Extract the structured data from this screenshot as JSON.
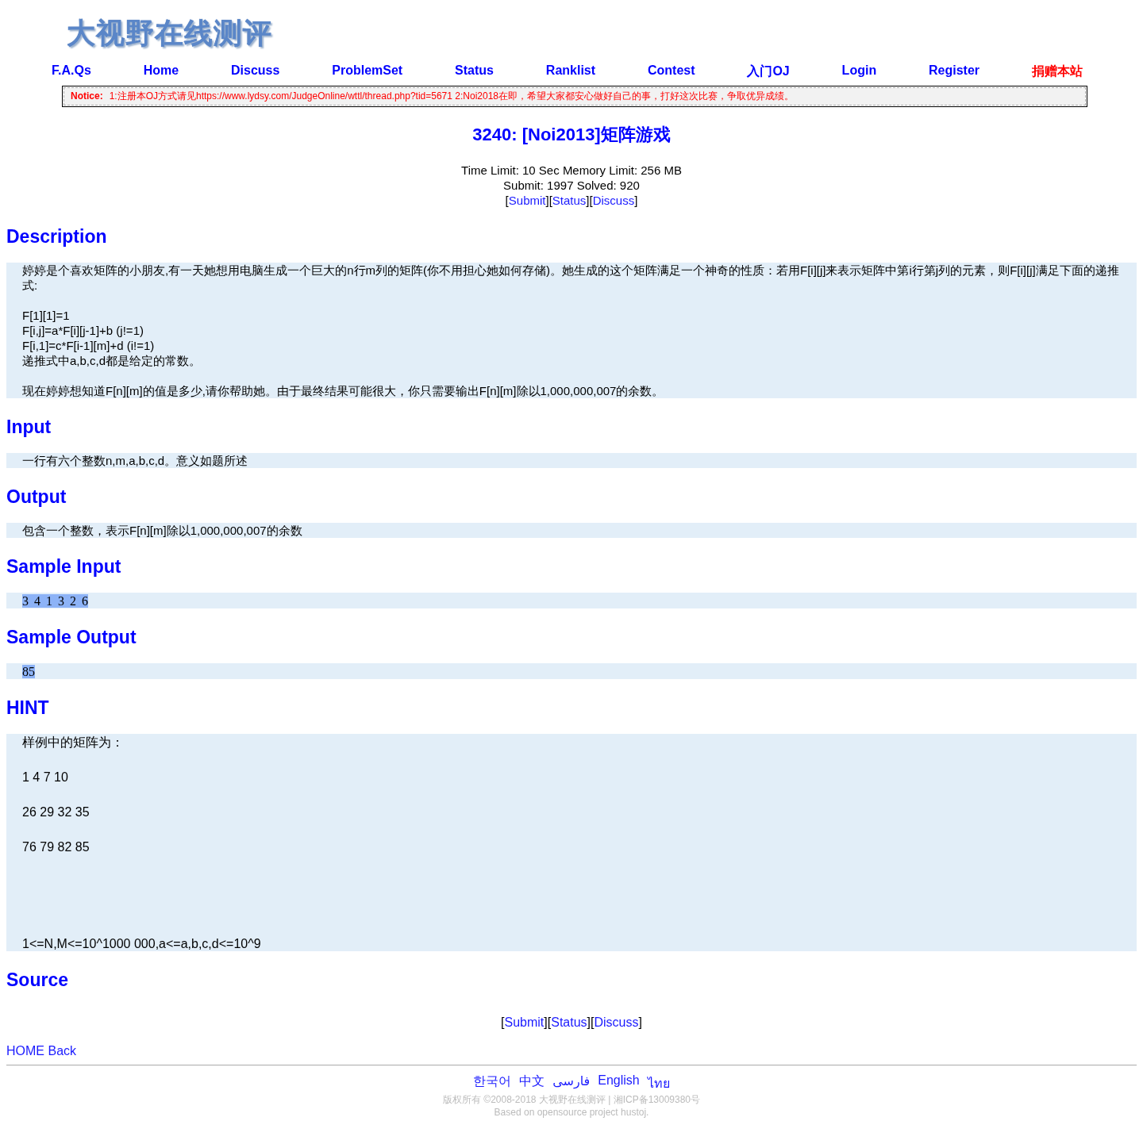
{
  "logo": {
    "text": "大视野在线测评"
  },
  "nav": [
    {
      "label": "F.A.Qs",
      "color": "#0000ff"
    },
    {
      "label": "Home",
      "color": "#0000ff"
    },
    {
      "label": "Discuss",
      "color": "#0000ff"
    },
    {
      "label": "ProblemSet",
      "color": "#0000ff"
    },
    {
      "label": "Status",
      "color": "#0000ff"
    },
    {
      "label": "Ranklist",
      "color": "#0000ff"
    },
    {
      "label": "Contest",
      "color": "#0000ff"
    },
    {
      "label": "入门OJ",
      "color": "#0000ff"
    },
    {
      "label": "Login",
      "color": "#0000ff"
    },
    {
      "label": "Register",
      "color": "#0000ff"
    },
    {
      "label": "捐赠本站",
      "color": "#ff0000"
    }
  ],
  "notice": {
    "label": "Notice:",
    "text": "1:注册本OJ方式请见https://www.lydsy.com/JudgeOnline/wttl/thread.php?tid=5671 2:Noi2018在即，希望大家都安心做好自己的事，打好这次比赛，争取优异成绩。"
  },
  "problem": {
    "title": "3240: [Noi2013]矩阵游戏",
    "limits": [
      "Time Limit: 10 Sec  Memory Limit: 256 MB",
      "Submit: 1997  Solved: 920"
    ],
    "actions": {
      "open": "[",
      "close": "]",
      "links": [
        "Submit",
        "Status",
        "Discuss"
      ]
    }
  },
  "sections": [
    {
      "heading": "Description",
      "kind": "text",
      "paragraphs": [
        [
          "婷婷是个喜欢矩阵的小朋友,有一天她想用电脑生成一个巨大的n行m列的矩阵(你不用担心她如何存储)。她生成的这个矩阵满足一个神奇的性质：若用F[i][j]来表示矩阵中第i行第j列的元素，则F[i][j]满足下面的递推式:"
        ],
        [
          "F[1][1]=1",
          "F[i,j]=a*F[i][j-1]+b (j!=1)",
          "F[i,1]=c*F[i-1][m]+d (i!=1)",
          "递推式中a,b,c,d都是给定的常数。"
        ],
        [
          "现在婷婷想知道F[n][m]的值是多少,请你帮助她。由于最终结果可能很大，你只需要输出F[n][m]除以1,000,000,007的余数。"
        ]
      ]
    },
    {
      "heading": "Input",
      "kind": "text",
      "paragraphs": [
        [
          "一行有六个整数n,m,a,b,c,d。意义如题所述"
        ]
      ]
    },
    {
      "heading": "Output",
      "kind": "text",
      "paragraphs": [
        [
          "包含一个整数，表示F[n][m]除以1,000,000,007的余数"
        ]
      ]
    },
    {
      "heading": "Sample Input",
      "kind": "sample",
      "highlighted": true,
      "paragraphs": [
        [
          "3 4 1 3 2 6"
        ]
      ]
    },
    {
      "heading": "Sample Output",
      "kind": "sample",
      "highlighted": true,
      "paragraphs": [
        [
          "85"
        ]
      ]
    },
    {
      "heading": "HINT",
      "kind": "hint",
      "paragraphs": [
        [
          "样例中的矩阵为："
        ],
        [
          "1 4 7 10"
        ],
        [
          "26 29 32 35"
        ],
        [
          "76 79 82 85"
        ],
        [
          "1<=N,M<=10^1000 000,a<=a,b,c,d<=10^9"
        ]
      ]
    },
    {
      "heading": "Source",
      "kind": "empty"
    }
  ],
  "bottom_actions": {
    "open": "[",
    "close": "]",
    "links": [
      "Submit",
      "Status",
      "Discuss"
    ]
  },
  "back_links": [
    "HOME",
    "Back"
  ],
  "footer": {
    "languages": [
      "한국어",
      "中文",
      "فارسی",
      "English",
      "ไทย"
    ],
    "copyright": "版权所有 ©2008-2018 大视野在线测评 | 湘ICP备13009380号",
    "based_on": "Based on opensource project hustoj."
  }
}
